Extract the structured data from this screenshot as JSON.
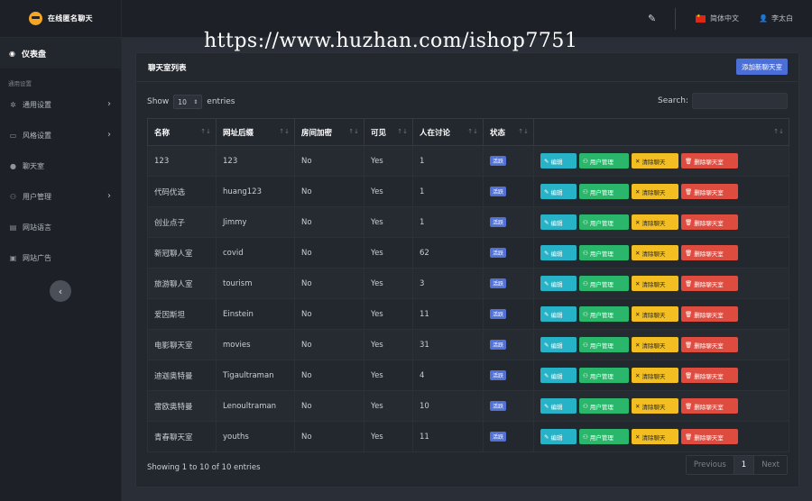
{
  "brand": {
    "name": "在线匿名聊天"
  },
  "sidebar": {
    "dashboard_label": "仪表盘",
    "group_label": "通用设置",
    "items": [
      {
        "label": "通用设置",
        "icon": "gear-icon",
        "has_children": true
      },
      {
        "label": "风格设置",
        "icon": "palette-icon",
        "has_children": true
      },
      {
        "label": "聊天室",
        "icon": "chat-icon",
        "has_children": false
      },
      {
        "label": "用户管理",
        "icon": "users-icon",
        "has_children": true
      },
      {
        "label": "网站语言",
        "icon": "language-icon",
        "has_children": false
      },
      {
        "label": "网站广告",
        "icon": "ads-icon",
        "has_children": false
      }
    ]
  },
  "topbar": {
    "language": "简体中文",
    "user": "李太白"
  },
  "watermark": "https://www.huzhan.com/ishop7751",
  "card": {
    "title": "聊天室列表",
    "add_button": "添加新聊天室",
    "show_label": "Show",
    "page_length": "10",
    "entries_label": "entries",
    "search_label": "Search:"
  },
  "table": {
    "headers": [
      "名称",
      "网址后缀",
      "房间加密",
      "可见",
      "人在讨论",
      "状态",
      ""
    ],
    "rows": [
      {
        "name": "123",
        "slug": "123",
        "encrypted": "No",
        "visible": "Yes",
        "online": "1",
        "status": "活跃"
      },
      {
        "name": "代码优选",
        "slug": "huang123",
        "encrypted": "No",
        "visible": "Yes",
        "online": "1",
        "status": "活跃"
      },
      {
        "name": "创业点子",
        "slug": "Jimmy",
        "encrypted": "No",
        "visible": "Yes",
        "online": "1",
        "status": "活跃"
      },
      {
        "name": "新冠聊人室",
        "slug": "covid",
        "encrypted": "No",
        "visible": "Yes",
        "online": "62",
        "status": "活跃"
      },
      {
        "name": "旅游聊人室",
        "slug": "tourism",
        "encrypted": "No",
        "visible": "Yes",
        "online": "3",
        "status": "活跃"
      },
      {
        "name": "爱因斯坦",
        "slug": "Einstein",
        "encrypted": "No",
        "visible": "Yes",
        "online": "11",
        "status": "活跃"
      },
      {
        "name": "电影聊天室",
        "slug": "movies",
        "encrypted": "No",
        "visible": "Yes",
        "online": "31",
        "status": "活跃"
      },
      {
        "name": "迪迦奥特曼",
        "slug": "Tigaultraman",
        "encrypted": "No",
        "visible": "Yes",
        "online": "4",
        "status": "活跃"
      },
      {
        "name": "雷欧奥特曼",
        "slug": "Lenoultraman",
        "encrypted": "No",
        "visible": "Yes",
        "online": "10",
        "status": "活跃"
      },
      {
        "name": "青春聊天室",
        "slug": "youths",
        "encrypted": "No",
        "visible": "Yes",
        "online": "11",
        "status": "活跃"
      }
    ],
    "actions": {
      "edit": "编辑",
      "users": "用户管理",
      "clear": "清除聊天",
      "delete": "删除聊天室"
    }
  },
  "footer": {
    "info": "Showing 1 to 10 of 10 entries",
    "prev": "Previous",
    "page": "1",
    "next": "Next"
  },
  "colors": {
    "accent": "#4b6fd6",
    "edit": "#27b3c7",
    "users": "#2ab66b",
    "clear": "#f2be22",
    "delete": "#de4b3f",
    "status": "#5271d8"
  }
}
